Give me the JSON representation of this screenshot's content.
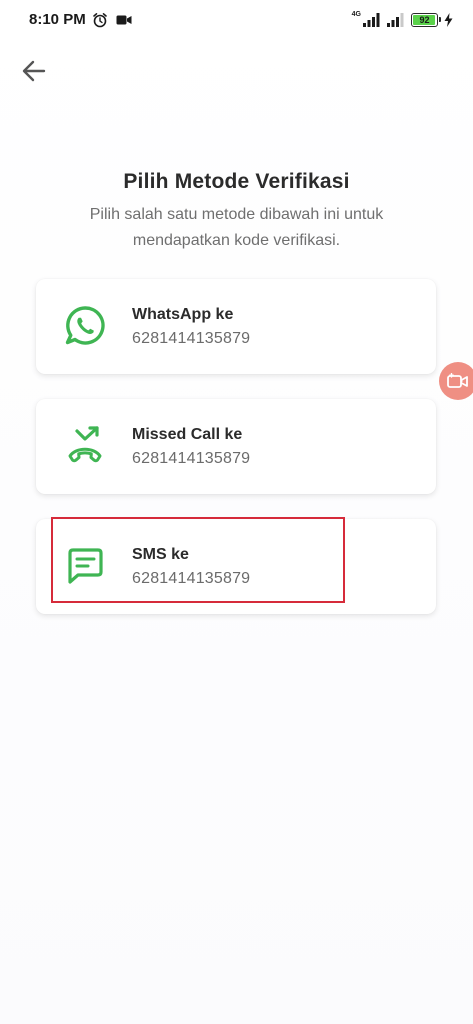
{
  "status_bar": {
    "time": "8:10 PM",
    "network": "4G",
    "battery": "92",
    "icons": [
      "alarm-icon",
      "video-record-icon",
      "signal-icon",
      "signal-icon",
      "charging-icon"
    ]
  },
  "header": {
    "back_icon": "arrow-left-icon",
    "title": "Pilih Metode Verifikasi",
    "subtitle": "Pilih salah satu metode dibawah ini untuk mendapatkan kode verifikasi."
  },
  "options": [
    {
      "label": "WhatsApp ke",
      "phone": "6281414135879",
      "icon": "whatsapp-icon"
    },
    {
      "label": "Missed Call ke",
      "phone": "6281414135879",
      "icon": "missed-call-icon"
    },
    {
      "label": "SMS ke",
      "phone": "6281414135879",
      "icon": "sms-icon"
    }
  ],
  "colors": {
    "accent_green": "#3fb553",
    "highlight_red": "#d62b3a",
    "float_bubble": "#ef8f83"
  },
  "floating_button": {
    "icon": "video-camera-icon"
  }
}
